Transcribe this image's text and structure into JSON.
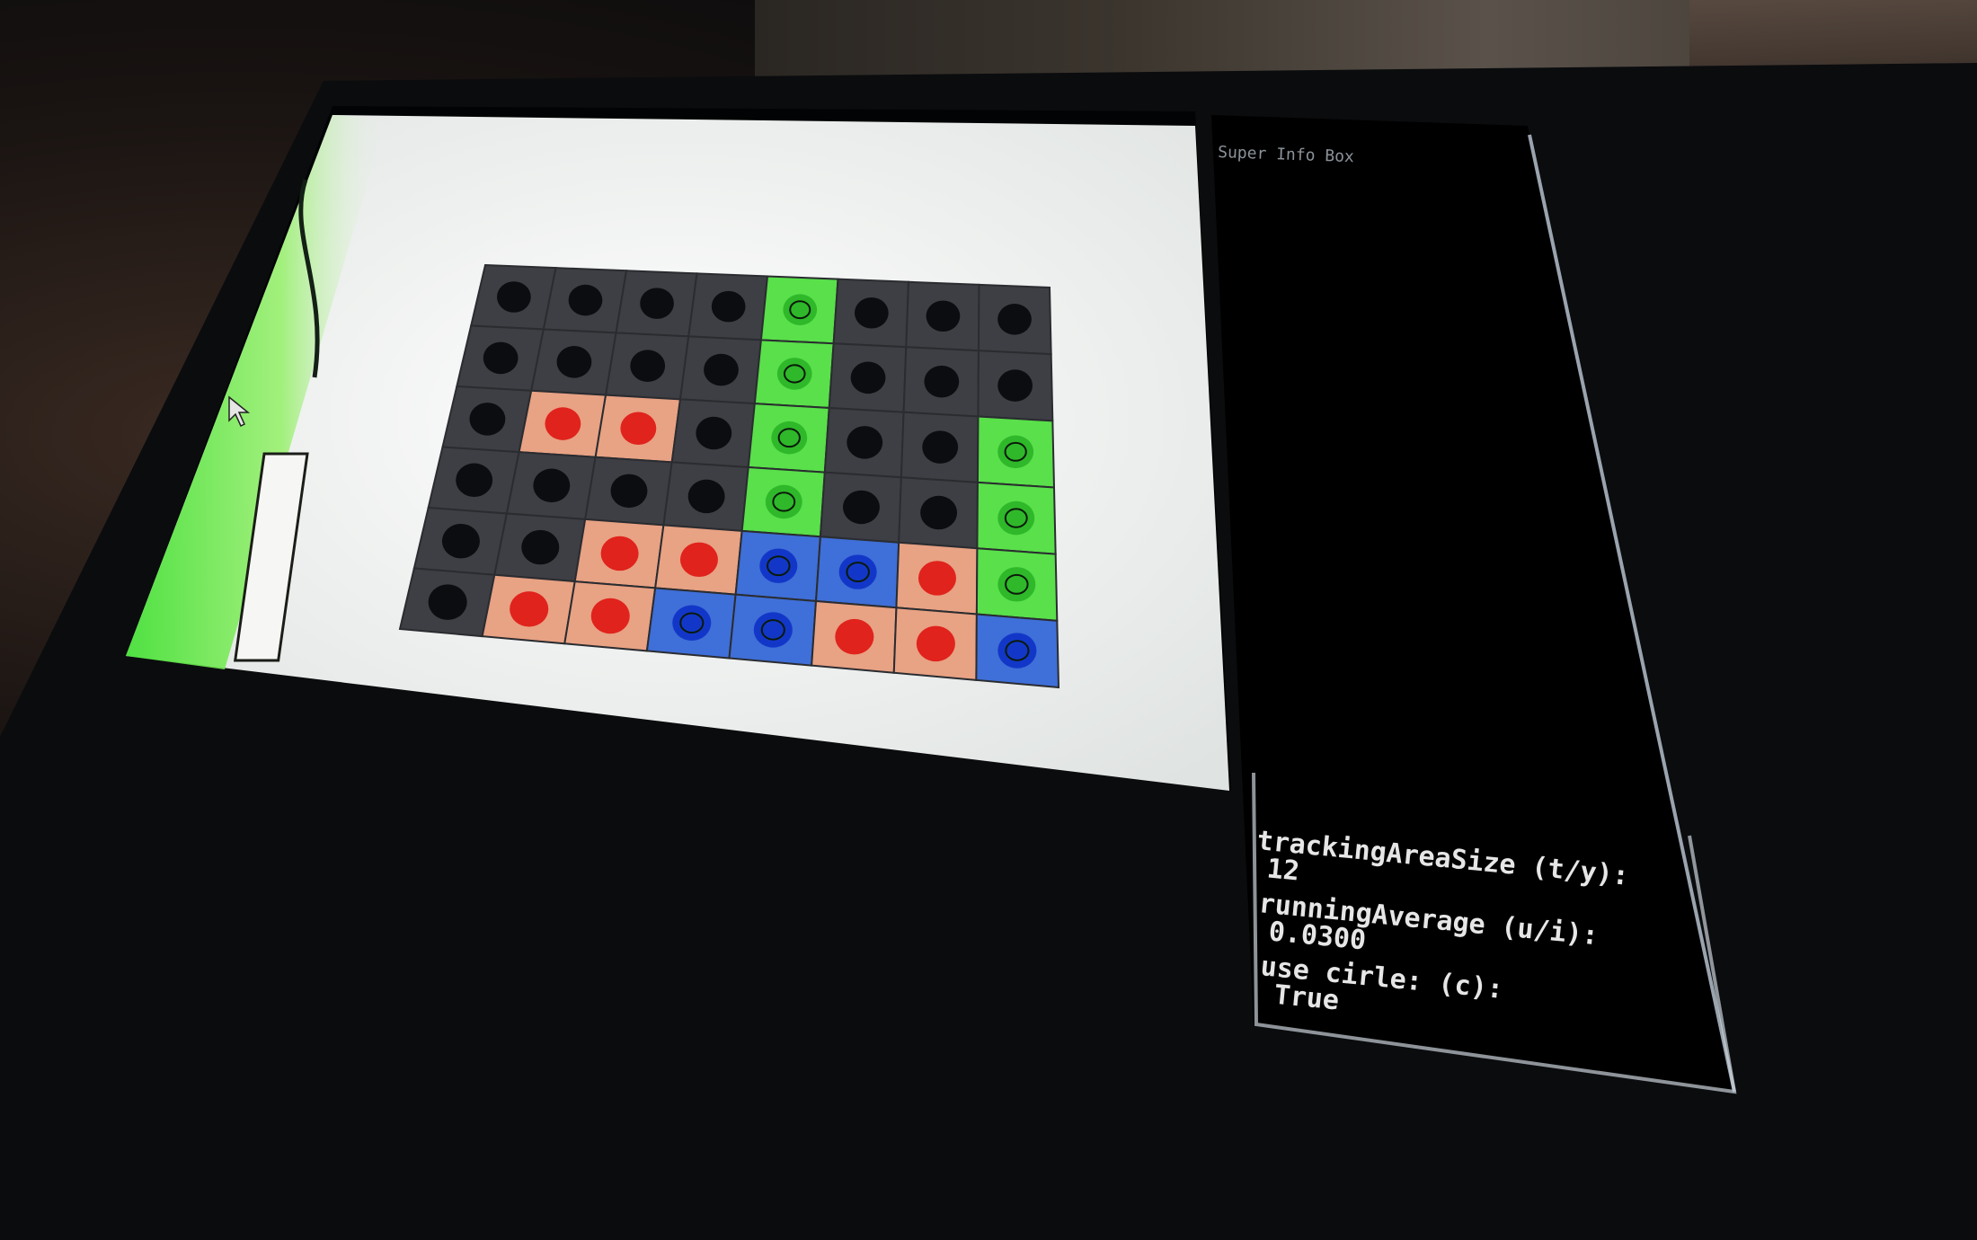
{
  "info_box": {
    "title": "Super Info Box",
    "params": [
      {
        "label": "trackingAreaSize (t/y):",
        "value": "12"
      },
      {
        "label": "runningAverage (u/i):",
        "value": "0.0300"
      },
      {
        "label": "use cirle: (c):",
        "value": "True"
      }
    ]
  },
  "grid": {
    "rows": [
      [
        "dark",
        "dark",
        "dark",
        "dark",
        "green",
        "dark",
        "dark",
        "dark"
      ],
      [
        "dark",
        "dark",
        "dark",
        "dark",
        "green",
        "dark",
        "dark",
        "dark"
      ],
      [
        "dark",
        "red",
        "red",
        "dark",
        "green",
        "dark",
        "dark",
        "green"
      ],
      [
        "dark",
        "dark",
        "dark",
        "dark",
        "green",
        "dark",
        "dark",
        "green"
      ],
      [
        "dark",
        "dark",
        "red",
        "red",
        "blue",
        "blue",
        "red",
        "green"
      ],
      [
        "dark",
        "red",
        "red",
        "blue",
        "blue",
        "red",
        "red",
        "blue"
      ]
    ]
  },
  "colors": {
    "dark": "#3d3f44",
    "red": "#e8a284",
    "green": "#59e04a",
    "blue": "#3f6fd8",
    "screen_bg": "#eef0ef",
    "info_text": "#e6e6e6"
  }
}
